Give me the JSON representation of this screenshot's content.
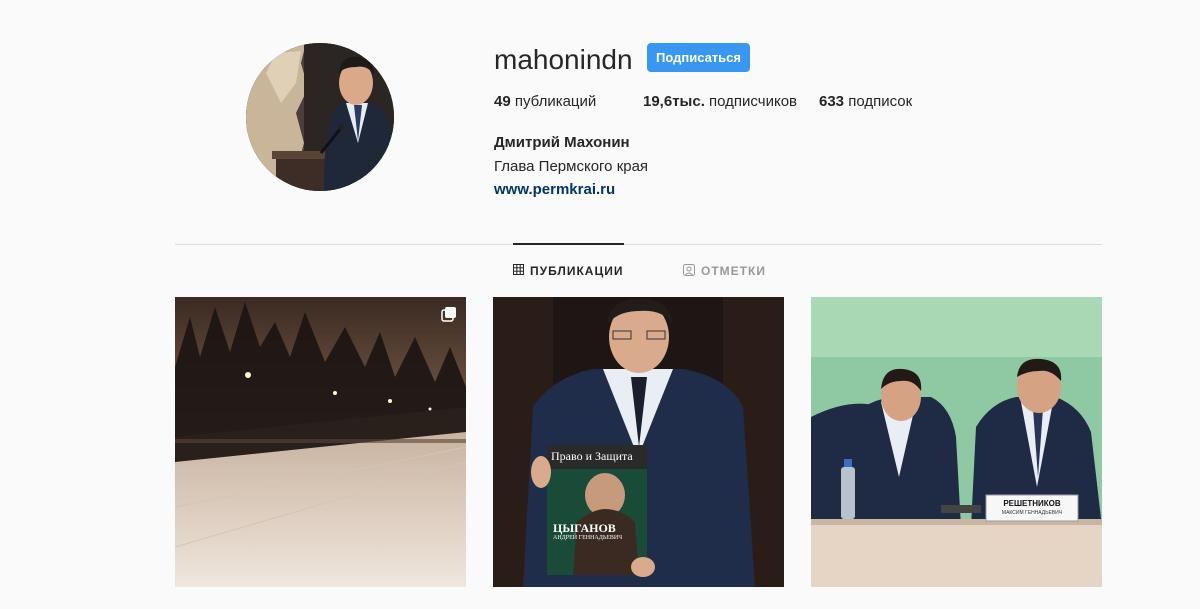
{
  "profile": {
    "username": "mahonindn",
    "follow_label": "Подписаться",
    "full_name": "Дмитрий Махонин",
    "bio": "Глава Пермского края",
    "website": "www.permkrai.ru"
  },
  "stats": {
    "posts_count": "49",
    "posts_label": "публикаций",
    "followers_count": "19,6тыс.",
    "followers_label": "подписчиков",
    "following_count": "633",
    "following_label": "подписок"
  },
  "tabs": [
    {
      "label": "ПУБЛИКАЦИИ",
      "icon": "grid-icon",
      "active": true
    },
    {
      "label": "ОТМЕТКИ",
      "icon": "tagged-icon",
      "active": false
    }
  ],
  "posts": [
    {
      "icon": "multiple-photos-icon"
    },
    {
      "magazine_title": "Право и Защита",
      "magazine_name": "ЦЫГАНОВ",
      "magazine_subname": "АНДРЕЙ ГЕННАДЬЕВИЧ"
    },
    {
      "nameplate_name": "РЕШЕТНИКОВ",
      "nameplate_sub": "МАКСИМ ГЕННАДЬЕВИЧ"
    }
  ],
  "colors": {
    "follow_button": "#3897f0",
    "link": "#003569",
    "background": "#fafafa",
    "divider": "#dbdbdb"
  }
}
